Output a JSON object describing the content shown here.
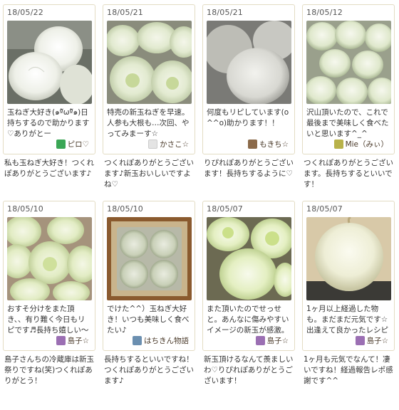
{
  "rows": [
    [
      {
        "date": "18/05/22",
        "comment": "玉ねぎ大好き(๑ºัωºั๑)日持ちするので助かります♡ありがとー",
        "user": "ピロ♡",
        "avatar_color": "#3aa655",
        "reply": "私も玉ねぎ大好き！つくれぽありがとうございます♪",
        "photo": "a"
      },
      {
        "date": "18/05/21",
        "comment": "特売の新玉ねぎを早速。人参も大根も…次回、やってみまーす☆",
        "user": "かさこ☆",
        "avatar_color": "#d9d9d9",
        "reply": "つくれぽありがとうございます♪新玉おいしいですよね♡",
        "photo": "b"
      },
      {
        "date": "18/05/21",
        "comment": "何度もリピしています(o^^o)助かります！！",
        "user": "もきち☆",
        "avatar_color": "#8b6a4a",
        "reply": "りぴれぽありがとうございます！長持ちするように♡",
        "photo": "c"
      },
      {
        "date": "18/05/12",
        "comment": "沢山頂いたので、これで最後まで美味しく食べたいと思います^_^",
        "user": "Mie（みぃ）",
        "avatar_color": "#b8b24a",
        "reply": "つくれぽありがとうございます。長持ちするといいです！",
        "photo": "d"
      }
    ],
    [
      {
        "date": "18/05/10",
        "comment": "おすそ分けをまた頂き、、有り難く今日もリピです♬長持ち嬉しい〜",
        "user": "島子☆",
        "avatar_color": "#9b6fb3",
        "reply": "島子さんちの冷蔵庫は新玉祭りですね(笑)つくれぽありがとう！",
        "photo": "e"
      },
      {
        "date": "18/05/10",
        "comment": "でけた^^）玉ねぎ大好き！いつも美味しく食べたい♪",
        "user": "はちきん物語",
        "avatar_color": "#6b8fb0",
        "reply": "長持ちするといいですね！つくれぽありがとうございます♪",
        "photo": "f"
      },
      {
        "date": "18/05/07",
        "comment": "また頂いたのでせっせと。あんなに傷みやすいイメージの新玉が感激。",
        "user": "島子☆",
        "avatar_color": "#9b6fb3",
        "reply": "新玉頂けるなんて羨ましいわ♡りぴれぽありがとうございます！",
        "photo": "g"
      },
      {
        "date": "18/05/07",
        "comment": "1ヶ月以上経過した物も。まだまだ元気です☆出逢えて良かったレシピ",
        "user": "島子☆",
        "avatar_color": "#9b6fb3",
        "reply": "1ヶ月も元気でなんて！凄いですね！経過報告レポ感謝です^^",
        "photo": "h"
      }
    ]
  ]
}
